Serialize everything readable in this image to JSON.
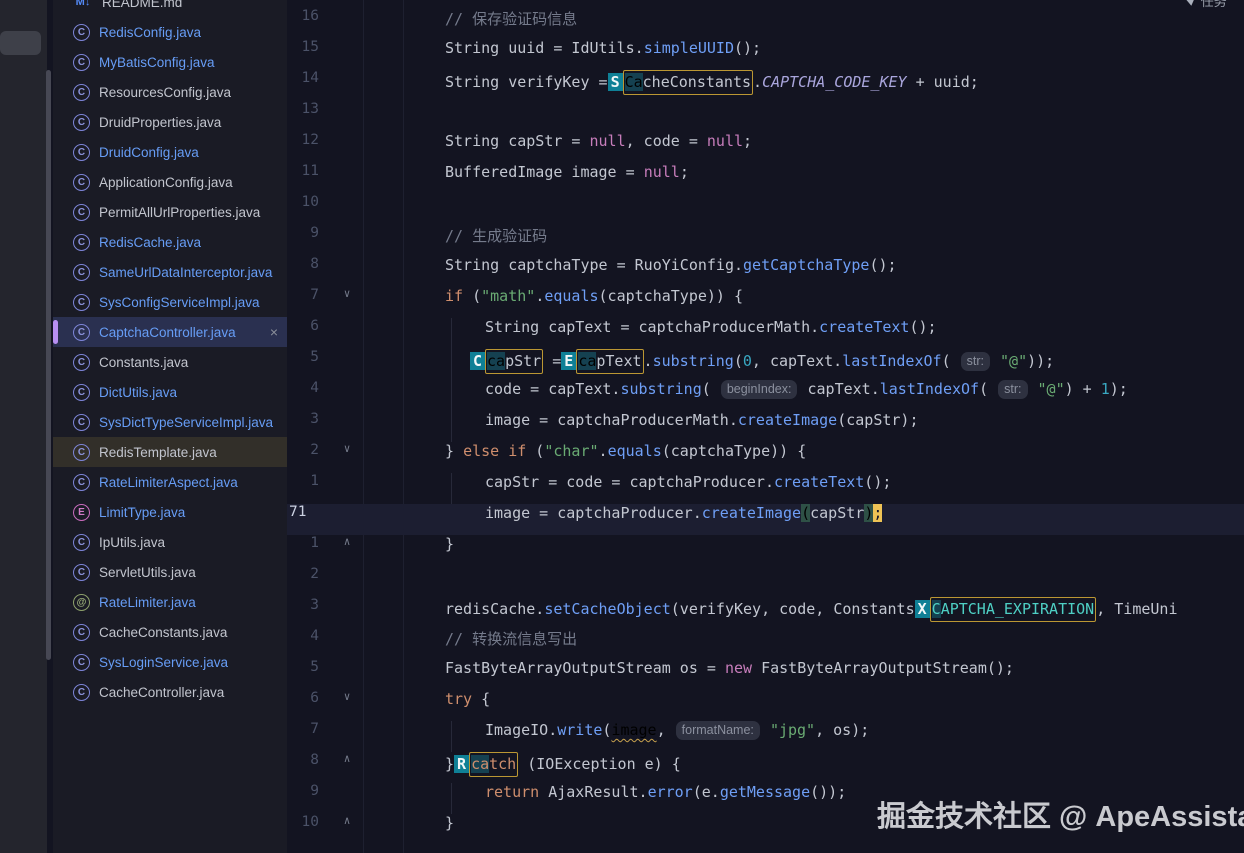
{
  "watermark": {
    "text": "掘金技术社区 @ ApeAssistant"
  },
  "top_right": {
    "text": "任务",
    "icon": "paper-plane-icon"
  },
  "colors": {
    "editor_bg": "#131421",
    "panel_bg": "#1a1b25",
    "stripe_bg": "#24252d",
    "selected_file_bg": "#2a3050",
    "selection_accent_bar": "#b88ff2",
    "flagged_file_bg": "#322f29",
    "modified_file_blue": "#679df6",
    "current_line_bg": "#1c1e31",
    "acejump_tag_teal": "#0f8096",
    "search_match_border": "#bb9733",
    "caret_block_yellow": "#eec355",
    "keyword_orange": "#cf8e6d",
    "keyword_pink": "#c77dbb",
    "string_green": "#6aab73",
    "method_blue": "#6f9ff6",
    "constant_lavender": "#aaa6dd",
    "constant_teal": "#4ecfc4",
    "comment_gray": "#757b8c",
    "number_cyan": "#39a8c2"
  },
  "sidebar": {
    "files": [
      {
        "label": "README.md",
        "icon": "markdown",
        "icon_text": "M↓",
        "modified": false,
        "selected": false,
        "flagged": false,
        "clipped": true
      },
      {
        "label": "RedisConfig.java",
        "icon": "class",
        "icon_text": "C",
        "modified": true,
        "selected": false,
        "flagged": false
      },
      {
        "label": "MyBatisConfig.java",
        "icon": "class",
        "icon_text": "C",
        "modified": true,
        "selected": false,
        "flagged": false
      },
      {
        "label": "ResourcesConfig.java",
        "icon": "class",
        "icon_text": "C",
        "modified": false,
        "selected": false,
        "flagged": false
      },
      {
        "label": "DruidProperties.java",
        "icon": "class",
        "icon_text": "C",
        "modified": false,
        "selected": false,
        "flagged": false
      },
      {
        "label": "DruidConfig.java",
        "icon": "class",
        "icon_text": "C",
        "modified": true,
        "selected": false,
        "flagged": false
      },
      {
        "label": "ApplicationConfig.java",
        "icon": "class",
        "icon_text": "C",
        "modified": false,
        "selected": false,
        "flagged": false
      },
      {
        "label": "PermitAllUrlProperties.java",
        "icon": "class",
        "icon_text": "C",
        "modified": false,
        "selected": false,
        "flagged": false
      },
      {
        "label": "RedisCache.java",
        "icon": "class",
        "icon_text": "C",
        "modified": true,
        "selected": false,
        "flagged": false
      },
      {
        "label": "SameUrlDataInterceptor.java",
        "icon": "class",
        "icon_text": "C",
        "modified": true,
        "selected": false,
        "flagged": false
      },
      {
        "label": "SysConfigServiceImpl.java",
        "icon": "class",
        "icon_text": "C",
        "modified": true,
        "selected": false,
        "flagged": false
      },
      {
        "label": "CaptchaController.java",
        "icon": "class",
        "icon_text": "C",
        "modified": true,
        "selected": true,
        "flagged": false,
        "close_icon": "×"
      },
      {
        "label": "Constants.java",
        "icon": "class",
        "icon_text": "C",
        "modified": false,
        "selected": false,
        "flagged": false
      },
      {
        "label": "DictUtils.java",
        "icon": "class",
        "icon_text": "C",
        "modified": true,
        "selected": false,
        "flagged": false
      },
      {
        "label": "SysDictTypeServiceImpl.java",
        "icon": "class",
        "icon_text": "C",
        "modified": true,
        "selected": false,
        "flagged": false
      },
      {
        "label": "RedisTemplate.java",
        "icon": "class",
        "icon_text": "C",
        "modified": false,
        "selected": false,
        "flagged": true
      },
      {
        "label": "RateLimiterAspect.java",
        "icon": "class",
        "icon_text": "C",
        "modified": true,
        "selected": false,
        "flagged": false
      },
      {
        "label": "LimitType.java",
        "icon": "enum",
        "icon_text": "E",
        "modified": true,
        "selected": false,
        "flagged": false
      },
      {
        "label": "IpUtils.java",
        "icon": "class",
        "icon_text": "C",
        "modified": false,
        "selected": false,
        "flagged": false
      },
      {
        "label": "ServletUtils.java",
        "icon": "class",
        "icon_text": "C",
        "modified": false,
        "selected": false,
        "flagged": false
      },
      {
        "label": "RateLimiter.java",
        "icon": "annotation",
        "icon_text": "@",
        "modified": true,
        "selected": false,
        "flagged": false
      },
      {
        "label": "CacheConstants.java",
        "icon": "class",
        "icon_text": "C",
        "modified": false,
        "selected": false,
        "flagged": false
      },
      {
        "label": "SysLoginService.java",
        "icon": "class",
        "icon_text": "C",
        "modified": true,
        "selected": false,
        "flagged": false
      },
      {
        "label": "CacheController.java",
        "icon": "class",
        "icon_text": "C",
        "modified": false,
        "selected": false,
        "flagged": false
      }
    ]
  },
  "editor": {
    "fold_glyphs": {
      "d": "∨",
      "u": "∧"
    },
    "pads": {
      "0": 158,
      "1": 198,
      "2": 183
    },
    "lines": [
      {
        "num": "16",
        "fold": "",
        "cur": false,
        "pad": "0",
        "toks": [
          [
            "cm",
            "// 保存验证码信息"
          ]
        ]
      },
      {
        "num": "15",
        "fold": "",
        "cur": false,
        "pad": "0",
        "toks": [
          [
            "x",
            "String uuid = IdUtils."
          ],
          [
            "ca",
            "simpleUUID"
          ],
          [
            "x",
            "();"
          ]
        ]
      },
      {
        "num": "14",
        "fold": "",
        "cur": false,
        "pad": "0",
        "toks": [
          [
            "x",
            "String verifyKey ="
          ],
          [
            "tg",
            "S"
          ],
          [
            "bx",
            [
              [
                "dm",
                "Ca"
              ],
              [
                "x",
                "cheConstants"
              ]
            ]
          ],
          [
            "x",
            "."
          ],
          [
            "co",
            "CAPTCHA_CODE_KEY"
          ],
          [
            "x",
            " + uuid;"
          ]
        ]
      },
      {
        "num": "13",
        "fold": "",
        "cur": false,
        "pad": "0",
        "toks": []
      },
      {
        "num": "12",
        "fold": "",
        "cur": false,
        "pad": "0",
        "toks": [
          [
            "x",
            "String capStr = "
          ],
          [
            "kp",
            "null"
          ],
          [
            "x",
            ", code = "
          ],
          [
            "kp",
            "null"
          ],
          [
            "x",
            ";"
          ]
        ]
      },
      {
        "num": "11",
        "fold": "",
        "cur": false,
        "pad": "0",
        "toks": [
          [
            "x",
            "BufferedImage image = "
          ],
          [
            "kp",
            "null"
          ],
          [
            "x",
            ";"
          ]
        ]
      },
      {
        "num": "10",
        "fold": "",
        "cur": false,
        "pad": "0",
        "toks": []
      },
      {
        "num": "9",
        "fold": "",
        "cur": false,
        "pad": "0",
        "toks": [
          [
            "cm",
            "// 生成验证码"
          ]
        ]
      },
      {
        "num": "8",
        "fold": "",
        "cur": false,
        "pad": "0",
        "toks": [
          [
            "x",
            "String captchaType = RuoYiConfig."
          ],
          [
            "ca",
            "getCaptchaType"
          ],
          [
            "x",
            "();"
          ]
        ]
      },
      {
        "num": "7",
        "fold": "d",
        "cur": false,
        "pad": "0",
        "toks": [
          [
            "kw",
            "if"
          ],
          [
            "x",
            " ("
          ],
          [
            "st",
            "\"math\""
          ],
          [
            "x",
            "."
          ],
          [
            "ca",
            "equals"
          ],
          [
            "x",
            "(captchaType)) {"
          ]
        ]
      },
      {
        "num": "6",
        "fold": "",
        "cur": false,
        "pad": "1",
        "toks": [
          [
            "x",
            "String capText = captchaProducerMath."
          ],
          [
            "ca",
            "createText"
          ],
          [
            "x",
            "();"
          ]
        ]
      },
      {
        "num": "5",
        "fold": "",
        "cur": false,
        "pad": "2",
        "toks": [
          [
            "tg",
            "C"
          ],
          [
            "bx",
            [
              [
                "dm",
                "ca"
              ],
              [
                "x",
                "pStr"
              ]
            ]
          ],
          [
            "x",
            " ="
          ],
          [
            "tg",
            "E"
          ],
          [
            "bx",
            [
              [
                "dm",
                "ca"
              ],
              [
                "x",
                "pText"
              ]
            ]
          ],
          [
            "x",
            "."
          ],
          [
            "ca",
            "substring"
          ],
          [
            "x",
            "("
          ],
          [
            "nu",
            "0"
          ],
          [
            "x",
            ", capText."
          ],
          [
            "ca",
            "lastIndexOf"
          ],
          [
            "x",
            "( "
          ],
          [
            "pl",
            "str:"
          ],
          [
            "x",
            " "
          ],
          [
            "st",
            "\"@\""
          ],
          [
            "x",
            "));"
          ]
        ]
      },
      {
        "num": "4",
        "fold": "",
        "cur": false,
        "pad": "1",
        "toks": [
          [
            "x",
            "code = capText."
          ],
          [
            "ca",
            "substring"
          ],
          [
            "x",
            "( "
          ],
          [
            "pl",
            "beginIndex:"
          ],
          [
            "x",
            " capText."
          ],
          [
            "ca",
            "lastIndexOf"
          ],
          [
            "x",
            "( "
          ],
          [
            "pl",
            "str:"
          ],
          [
            "x",
            " "
          ],
          [
            "st",
            "\"@\""
          ],
          [
            "x",
            ") + "
          ],
          [
            "nu",
            "1"
          ],
          [
            "x",
            ");"
          ]
        ]
      },
      {
        "num": "3",
        "fold": "",
        "cur": false,
        "pad": "1",
        "toks": [
          [
            "x",
            "image = captchaProducerMath."
          ],
          [
            "ca",
            "createImage"
          ],
          [
            "x",
            "(capStr);"
          ]
        ]
      },
      {
        "num": "2",
        "fold": "d",
        "cur": false,
        "pad": "0",
        "toks": [
          [
            "x",
            "} "
          ],
          [
            "kw",
            "else"
          ],
          [
            "x",
            " "
          ],
          [
            "kw",
            "if"
          ],
          [
            "x",
            " ("
          ],
          [
            "st",
            "\"char\""
          ],
          [
            "x",
            "."
          ],
          [
            "ca",
            "equals"
          ],
          [
            "x",
            "(captchaType)) {"
          ]
        ]
      },
      {
        "num": "1",
        "fold": "",
        "cur": false,
        "pad": "1",
        "toks": [
          [
            "x",
            "capStr = code = captchaProducer."
          ],
          [
            "ca",
            "createText"
          ],
          [
            "x",
            "();"
          ]
        ]
      },
      {
        "num": "71",
        "fold": "",
        "cur": true,
        "pad": "1",
        "toks": [
          [
            "x",
            "image = captchaProducer."
          ],
          [
            "ca",
            "createImage"
          ],
          [
            "br",
            "("
          ],
          [
            "x",
            "capStr"
          ],
          [
            "br",
            ")"
          ],
          [
            "cr",
            ";"
          ]
        ]
      },
      {
        "num": "1",
        "fold": "u",
        "cur": false,
        "pad": "0",
        "toks": [
          [
            "x",
            "}"
          ]
        ]
      },
      {
        "num": "2",
        "fold": "",
        "cur": false,
        "pad": "0",
        "toks": []
      },
      {
        "num": "3",
        "fold": "",
        "cur": false,
        "pad": "0",
        "toks": [
          [
            "x",
            "redisCache."
          ],
          [
            "ca",
            "setCacheObject"
          ],
          [
            "x",
            "(verifyKey, code, Constants"
          ],
          [
            "tg",
            "X"
          ],
          [
            "bx",
            [
              [
                "dm ct",
                "C"
              ],
              [
                "ct",
                "APTCHA_EXPIRATION"
              ]
            ]
          ],
          [
            "x",
            ", TimeUni"
          ]
        ]
      },
      {
        "num": "4",
        "fold": "",
        "cur": false,
        "pad": "0",
        "toks": [
          [
            "cm",
            "// 转换流信息写出"
          ]
        ]
      },
      {
        "num": "5",
        "fold": "",
        "cur": false,
        "pad": "0",
        "toks": [
          [
            "x",
            "FastByteArrayOutputStream os = "
          ],
          [
            "kp",
            "new"
          ],
          [
            "x",
            " FastByteArrayOutputStream();"
          ]
        ]
      },
      {
        "num": "6",
        "fold": "d",
        "cur": false,
        "pad": "0",
        "toks": [
          [
            "kw",
            "try"
          ],
          [
            "x",
            " {"
          ]
        ]
      },
      {
        "num": "7",
        "fold": "",
        "cur": false,
        "pad": "1",
        "toks": [
          [
            "x",
            "ImageIO."
          ],
          [
            "ca",
            "write"
          ],
          [
            "x",
            "("
          ],
          [
            "wr",
            "image"
          ],
          [
            "x",
            ", "
          ],
          [
            "pl",
            "formatName:"
          ],
          [
            "x",
            " "
          ],
          [
            "st",
            "\"jpg\""
          ],
          [
            "x",
            ", os);"
          ]
        ]
      },
      {
        "num": "8",
        "fold": "u",
        "cur": false,
        "pad": "0",
        "toks": [
          [
            "x",
            "}"
          ],
          [
            "tg",
            "R"
          ],
          [
            "bx",
            [
              [
                "dm kw",
                "ca"
              ],
              [
                "kw",
                "tch"
              ]
            ]
          ],
          [
            "x",
            " (IOException e) {"
          ]
        ]
      },
      {
        "num": "9",
        "fold": "",
        "cur": false,
        "pad": "1",
        "toks": [
          [
            "kw",
            "return"
          ],
          [
            "x",
            " AjaxResult."
          ],
          [
            "ca",
            "error"
          ],
          [
            "x",
            "(e."
          ],
          [
            "ca",
            "getMessage"
          ],
          [
            "x",
            "());"
          ]
        ]
      },
      {
        "num": "10",
        "fold": "u",
        "cur": false,
        "pad": "0",
        "toks": [
          [
            "x",
            "}"
          ]
        ]
      }
    ]
  }
}
